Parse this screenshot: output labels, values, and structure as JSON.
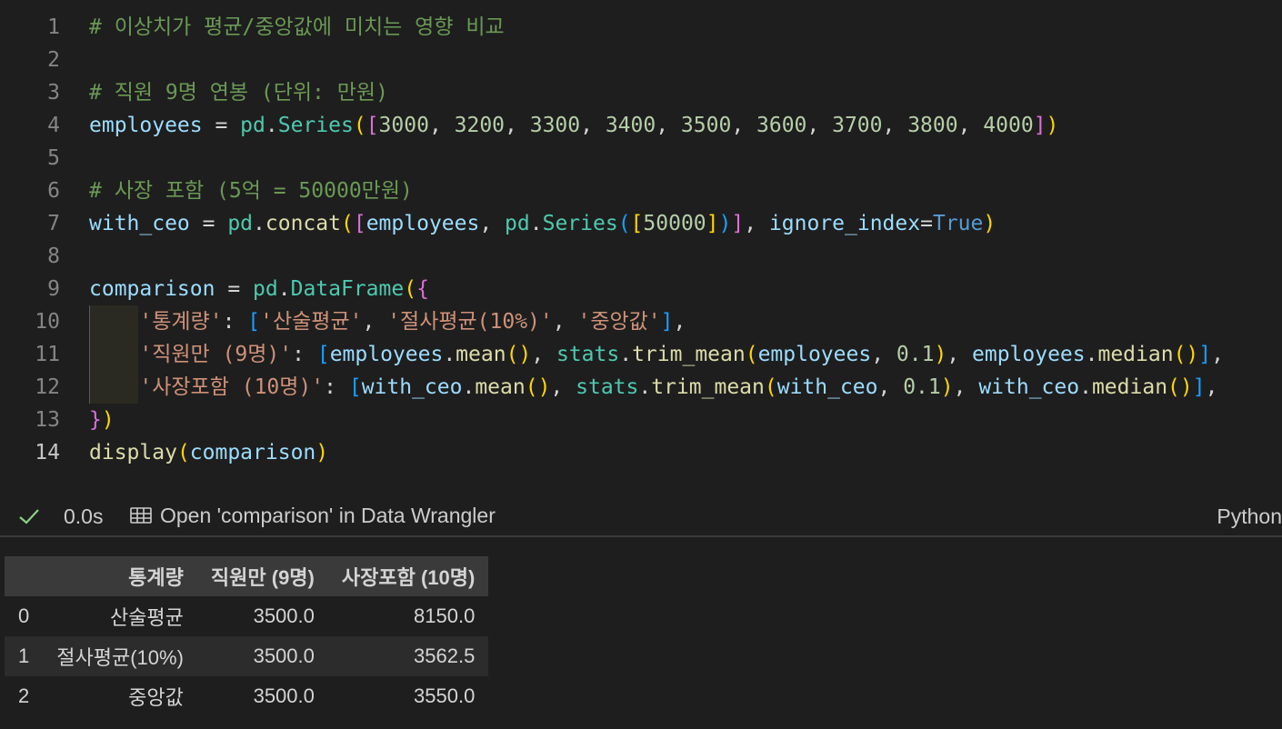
{
  "editor": {
    "lines": [
      {
        "n": "1",
        "tokens": [
          {
            "c": "cm",
            "t": "# 이상치가 평균/중앙값에 미치는 영향 비교"
          }
        ]
      },
      {
        "n": "2",
        "tokens": []
      },
      {
        "n": "3",
        "tokens": [
          {
            "c": "cm",
            "t": "# 직원 9명 연봉 (단위: 만원)"
          }
        ]
      },
      {
        "n": "4",
        "tokens": [
          {
            "c": "id",
            "t": "employees"
          },
          {
            "c": "op",
            "t": " = "
          },
          {
            "c": "cls",
            "t": "pd"
          },
          {
            "c": "op",
            "t": "."
          },
          {
            "c": "cls",
            "t": "Series"
          },
          {
            "c": "b1",
            "t": "("
          },
          {
            "c": "b2",
            "t": "["
          },
          {
            "c": "num",
            "t": "3000"
          },
          {
            "c": "op",
            "t": ", "
          },
          {
            "c": "num",
            "t": "3200"
          },
          {
            "c": "op",
            "t": ", "
          },
          {
            "c": "num",
            "t": "3300"
          },
          {
            "c": "op",
            "t": ", "
          },
          {
            "c": "num",
            "t": "3400"
          },
          {
            "c": "op",
            "t": ", "
          },
          {
            "c": "num",
            "t": "3500"
          },
          {
            "c": "op",
            "t": ", "
          },
          {
            "c": "num",
            "t": "3600"
          },
          {
            "c": "op",
            "t": ", "
          },
          {
            "c": "num",
            "t": "3700"
          },
          {
            "c": "op",
            "t": ", "
          },
          {
            "c": "num",
            "t": "3800"
          },
          {
            "c": "op",
            "t": ", "
          },
          {
            "c": "num",
            "t": "4000"
          },
          {
            "c": "b2",
            "t": "]"
          },
          {
            "c": "b1",
            "t": ")"
          }
        ]
      },
      {
        "n": "5",
        "tokens": []
      },
      {
        "n": "6",
        "tokens": [
          {
            "c": "cm",
            "t": "# 사장 포함 (5억 = 50000만원)"
          }
        ]
      },
      {
        "n": "7",
        "tokens": [
          {
            "c": "id",
            "t": "with_ceo"
          },
          {
            "c": "op",
            "t": " = "
          },
          {
            "c": "cls",
            "t": "pd"
          },
          {
            "c": "op",
            "t": "."
          },
          {
            "c": "fn",
            "t": "concat"
          },
          {
            "c": "b1",
            "t": "("
          },
          {
            "c": "b2",
            "t": "["
          },
          {
            "c": "id",
            "t": "employees"
          },
          {
            "c": "op",
            "t": ", "
          },
          {
            "c": "cls",
            "t": "pd"
          },
          {
            "c": "op",
            "t": "."
          },
          {
            "c": "cls",
            "t": "Series"
          },
          {
            "c": "b3",
            "t": "("
          },
          {
            "c": "b1",
            "t": "["
          },
          {
            "c": "num",
            "t": "50000"
          },
          {
            "c": "b1",
            "t": "]"
          },
          {
            "c": "b3",
            "t": ")"
          },
          {
            "c": "b2",
            "t": "]"
          },
          {
            "c": "op",
            "t": ", "
          },
          {
            "c": "id",
            "t": "ignore_index"
          },
          {
            "c": "op",
            "t": "="
          },
          {
            "c": "kw",
            "t": "True"
          },
          {
            "c": "b1",
            "t": ")"
          }
        ]
      },
      {
        "n": "8",
        "tokens": []
      },
      {
        "n": "9",
        "tokens": [
          {
            "c": "id",
            "t": "comparison"
          },
          {
            "c": "op",
            "t": " = "
          },
          {
            "c": "cls",
            "t": "pd"
          },
          {
            "c": "op",
            "t": "."
          },
          {
            "c": "cls",
            "t": "DataFrame"
          },
          {
            "c": "b1",
            "t": "("
          },
          {
            "c": "b2",
            "t": "{"
          }
        ]
      },
      {
        "n": "10",
        "indent": true,
        "tokens": [
          {
            "c": "op",
            "t": "    "
          },
          {
            "c": "str",
            "t": "'통계량'"
          },
          {
            "c": "op",
            "t": ": "
          },
          {
            "c": "b3",
            "t": "["
          },
          {
            "c": "str",
            "t": "'산술평균'"
          },
          {
            "c": "op",
            "t": ", "
          },
          {
            "c": "str",
            "t": "'절사평균(10%)'"
          },
          {
            "c": "op",
            "t": ", "
          },
          {
            "c": "str",
            "t": "'중앙값'"
          },
          {
            "c": "b3",
            "t": "]"
          },
          {
            "c": "op",
            "t": ","
          }
        ]
      },
      {
        "n": "11",
        "indent": true,
        "tokens": [
          {
            "c": "op",
            "t": "    "
          },
          {
            "c": "str",
            "t": "'직원만 (9명)'"
          },
          {
            "c": "op",
            "t": ": "
          },
          {
            "c": "b3",
            "t": "["
          },
          {
            "c": "id",
            "t": "employees"
          },
          {
            "c": "op",
            "t": "."
          },
          {
            "c": "fn",
            "t": "mean"
          },
          {
            "c": "b1",
            "t": "()"
          },
          {
            "c": "op",
            "t": ", "
          },
          {
            "c": "cls",
            "t": "stats"
          },
          {
            "c": "op",
            "t": "."
          },
          {
            "c": "fn",
            "t": "trim_mean"
          },
          {
            "c": "b1",
            "t": "("
          },
          {
            "c": "id",
            "t": "employees"
          },
          {
            "c": "op",
            "t": ", "
          },
          {
            "c": "num",
            "t": "0.1"
          },
          {
            "c": "b1",
            "t": ")"
          },
          {
            "c": "op",
            "t": ", "
          },
          {
            "c": "id",
            "t": "employees"
          },
          {
            "c": "op",
            "t": "."
          },
          {
            "c": "fn",
            "t": "median"
          },
          {
            "c": "b1",
            "t": "()"
          },
          {
            "c": "b3",
            "t": "]"
          },
          {
            "c": "op",
            "t": ","
          }
        ]
      },
      {
        "n": "12",
        "indent": true,
        "tokens": [
          {
            "c": "op",
            "t": "    "
          },
          {
            "c": "str",
            "t": "'사장포함 (10명)'"
          },
          {
            "c": "op",
            "t": ": "
          },
          {
            "c": "b3",
            "t": "["
          },
          {
            "c": "id",
            "t": "with_ceo"
          },
          {
            "c": "op",
            "t": "."
          },
          {
            "c": "fn",
            "t": "mean"
          },
          {
            "c": "b1",
            "t": "()"
          },
          {
            "c": "op",
            "t": ", "
          },
          {
            "c": "cls",
            "t": "stats"
          },
          {
            "c": "op",
            "t": "."
          },
          {
            "c": "fn",
            "t": "trim_mean"
          },
          {
            "c": "b1",
            "t": "("
          },
          {
            "c": "id",
            "t": "with_ceo"
          },
          {
            "c": "op",
            "t": ", "
          },
          {
            "c": "num",
            "t": "0.1"
          },
          {
            "c": "b1",
            "t": ")"
          },
          {
            "c": "op",
            "t": ", "
          },
          {
            "c": "id",
            "t": "with_ceo"
          },
          {
            "c": "op",
            "t": "."
          },
          {
            "c": "fn",
            "t": "median"
          },
          {
            "c": "b1",
            "t": "()"
          },
          {
            "c": "b3",
            "t": "]"
          },
          {
            "c": "op",
            "t": ","
          }
        ]
      },
      {
        "n": "13",
        "tokens": [
          {
            "c": "b2",
            "t": "}"
          },
          {
            "c": "b1",
            "t": ")"
          }
        ]
      },
      {
        "n": "14",
        "current": true,
        "tokens": [
          {
            "c": "fn",
            "t": "display"
          },
          {
            "c": "b1",
            "t": "("
          },
          {
            "c": "id",
            "t": "comparison"
          },
          {
            "c": "b1",
            "t": ")"
          }
        ]
      }
    ]
  },
  "status": {
    "duration": "0.0s",
    "data_wrangler_label": "Open 'comparison' in Data Wrangler",
    "language": "Python",
    "icons": {
      "success": "check-icon",
      "wrangler": "table-icon"
    },
    "colors": {
      "success": "#89d185"
    }
  },
  "output_table": {
    "columns": [
      "",
      "통계량",
      "직원만 (9명)",
      "사장포함 (10명)"
    ],
    "rows": [
      [
        "0",
        "산술평균",
        "3500.0",
        "8150.0"
      ],
      [
        "1",
        "절사평균(10%)",
        "3500.0",
        "3562.5"
      ],
      [
        "2",
        "중앙값",
        "3500.0",
        "3550.0"
      ]
    ]
  }
}
